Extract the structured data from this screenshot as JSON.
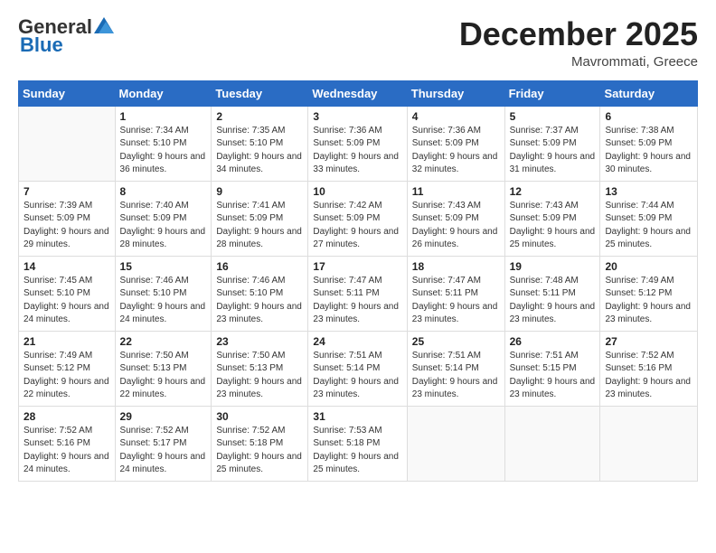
{
  "header": {
    "logo_general": "General",
    "logo_blue": "Blue",
    "month": "December 2025",
    "location": "Mavrommati, Greece"
  },
  "days_of_week": [
    "Sunday",
    "Monday",
    "Tuesday",
    "Wednesday",
    "Thursday",
    "Friday",
    "Saturday"
  ],
  "weeks": [
    [
      {
        "num": "",
        "sunrise": "",
        "sunset": "",
        "daylight": ""
      },
      {
        "num": "1",
        "sunrise": "Sunrise: 7:34 AM",
        "sunset": "Sunset: 5:10 PM",
        "daylight": "Daylight: 9 hours and 36 minutes."
      },
      {
        "num": "2",
        "sunrise": "Sunrise: 7:35 AM",
        "sunset": "Sunset: 5:10 PM",
        "daylight": "Daylight: 9 hours and 34 minutes."
      },
      {
        "num": "3",
        "sunrise": "Sunrise: 7:36 AM",
        "sunset": "Sunset: 5:09 PM",
        "daylight": "Daylight: 9 hours and 33 minutes."
      },
      {
        "num": "4",
        "sunrise": "Sunrise: 7:36 AM",
        "sunset": "Sunset: 5:09 PM",
        "daylight": "Daylight: 9 hours and 32 minutes."
      },
      {
        "num": "5",
        "sunrise": "Sunrise: 7:37 AM",
        "sunset": "Sunset: 5:09 PM",
        "daylight": "Daylight: 9 hours and 31 minutes."
      },
      {
        "num": "6",
        "sunrise": "Sunrise: 7:38 AM",
        "sunset": "Sunset: 5:09 PM",
        "daylight": "Daylight: 9 hours and 30 minutes."
      }
    ],
    [
      {
        "num": "7",
        "sunrise": "Sunrise: 7:39 AM",
        "sunset": "Sunset: 5:09 PM",
        "daylight": "Daylight: 9 hours and 29 minutes."
      },
      {
        "num": "8",
        "sunrise": "Sunrise: 7:40 AM",
        "sunset": "Sunset: 5:09 PM",
        "daylight": "Daylight: 9 hours and 28 minutes."
      },
      {
        "num": "9",
        "sunrise": "Sunrise: 7:41 AM",
        "sunset": "Sunset: 5:09 PM",
        "daylight": "Daylight: 9 hours and 28 minutes."
      },
      {
        "num": "10",
        "sunrise": "Sunrise: 7:42 AM",
        "sunset": "Sunset: 5:09 PM",
        "daylight": "Daylight: 9 hours and 27 minutes."
      },
      {
        "num": "11",
        "sunrise": "Sunrise: 7:43 AM",
        "sunset": "Sunset: 5:09 PM",
        "daylight": "Daylight: 9 hours and 26 minutes."
      },
      {
        "num": "12",
        "sunrise": "Sunrise: 7:43 AM",
        "sunset": "Sunset: 5:09 PM",
        "daylight": "Daylight: 9 hours and 25 minutes."
      },
      {
        "num": "13",
        "sunrise": "Sunrise: 7:44 AM",
        "sunset": "Sunset: 5:09 PM",
        "daylight": "Daylight: 9 hours and 25 minutes."
      }
    ],
    [
      {
        "num": "14",
        "sunrise": "Sunrise: 7:45 AM",
        "sunset": "Sunset: 5:10 PM",
        "daylight": "Daylight: 9 hours and 24 minutes."
      },
      {
        "num": "15",
        "sunrise": "Sunrise: 7:46 AM",
        "sunset": "Sunset: 5:10 PM",
        "daylight": "Daylight: 9 hours and 24 minutes."
      },
      {
        "num": "16",
        "sunrise": "Sunrise: 7:46 AM",
        "sunset": "Sunset: 5:10 PM",
        "daylight": "Daylight: 9 hours and 23 minutes."
      },
      {
        "num": "17",
        "sunrise": "Sunrise: 7:47 AM",
        "sunset": "Sunset: 5:11 PM",
        "daylight": "Daylight: 9 hours and 23 minutes."
      },
      {
        "num": "18",
        "sunrise": "Sunrise: 7:47 AM",
        "sunset": "Sunset: 5:11 PM",
        "daylight": "Daylight: 9 hours and 23 minutes."
      },
      {
        "num": "19",
        "sunrise": "Sunrise: 7:48 AM",
        "sunset": "Sunset: 5:11 PM",
        "daylight": "Daylight: 9 hours and 23 minutes."
      },
      {
        "num": "20",
        "sunrise": "Sunrise: 7:49 AM",
        "sunset": "Sunset: 5:12 PM",
        "daylight": "Daylight: 9 hours and 23 minutes."
      }
    ],
    [
      {
        "num": "21",
        "sunrise": "Sunrise: 7:49 AM",
        "sunset": "Sunset: 5:12 PM",
        "daylight": "Daylight: 9 hours and 22 minutes."
      },
      {
        "num": "22",
        "sunrise": "Sunrise: 7:50 AM",
        "sunset": "Sunset: 5:13 PM",
        "daylight": "Daylight: 9 hours and 22 minutes."
      },
      {
        "num": "23",
        "sunrise": "Sunrise: 7:50 AM",
        "sunset": "Sunset: 5:13 PM",
        "daylight": "Daylight: 9 hours and 23 minutes."
      },
      {
        "num": "24",
        "sunrise": "Sunrise: 7:51 AM",
        "sunset": "Sunset: 5:14 PM",
        "daylight": "Daylight: 9 hours and 23 minutes."
      },
      {
        "num": "25",
        "sunrise": "Sunrise: 7:51 AM",
        "sunset": "Sunset: 5:14 PM",
        "daylight": "Daylight: 9 hours and 23 minutes."
      },
      {
        "num": "26",
        "sunrise": "Sunrise: 7:51 AM",
        "sunset": "Sunset: 5:15 PM",
        "daylight": "Daylight: 9 hours and 23 minutes."
      },
      {
        "num": "27",
        "sunrise": "Sunrise: 7:52 AM",
        "sunset": "Sunset: 5:16 PM",
        "daylight": "Daylight: 9 hours and 23 minutes."
      }
    ],
    [
      {
        "num": "28",
        "sunrise": "Sunrise: 7:52 AM",
        "sunset": "Sunset: 5:16 PM",
        "daylight": "Daylight: 9 hours and 24 minutes."
      },
      {
        "num": "29",
        "sunrise": "Sunrise: 7:52 AM",
        "sunset": "Sunset: 5:17 PM",
        "daylight": "Daylight: 9 hours and 24 minutes."
      },
      {
        "num": "30",
        "sunrise": "Sunrise: 7:52 AM",
        "sunset": "Sunset: 5:18 PM",
        "daylight": "Daylight: 9 hours and 25 minutes."
      },
      {
        "num": "31",
        "sunrise": "Sunrise: 7:53 AM",
        "sunset": "Sunset: 5:18 PM",
        "daylight": "Daylight: 9 hours and 25 minutes."
      },
      {
        "num": "",
        "sunrise": "",
        "sunset": "",
        "daylight": ""
      },
      {
        "num": "",
        "sunrise": "",
        "sunset": "",
        "daylight": ""
      },
      {
        "num": "",
        "sunrise": "",
        "sunset": "",
        "daylight": ""
      }
    ]
  ]
}
